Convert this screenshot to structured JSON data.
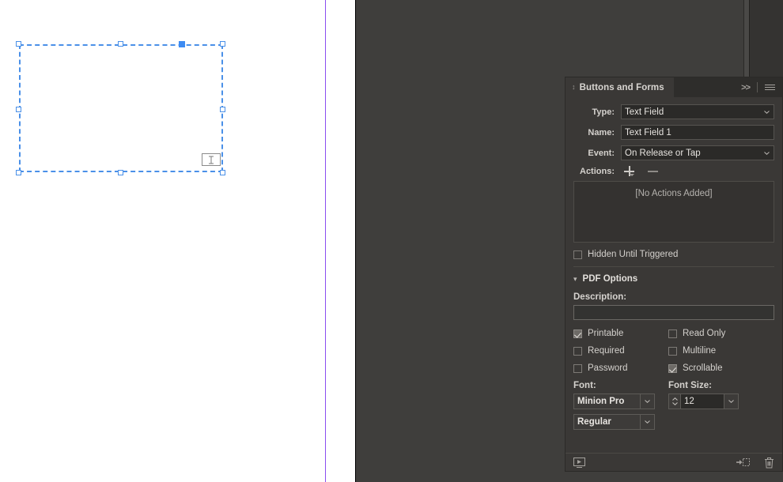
{
  "panel": {
    "tab_title": "Buttons and Forms",
    "dock_icon": "collapse-arrows-icon",
    "expand_icon": ">>",
    "menu_icon": "panel-menu-icon",
    "fields": {
      "type_label": "Type:",
      "type_value": "Text Field",
      "name_label": "Name:",
      "name_value": "Text Field 1",
      "event_label": "Event:",
      "event_value": "On Release or Tap",
      "actions_label": "Actions:",
      "add_action_label": "+",
      "remove_action_label": "−",
      "actions_empty": "[No Actions Added]"
    },
    "hidden_until_triggered": {
      "label": "Hidden Until Triggered",
      "checked": false
    },
    "pdf_options": {
      "title": "PDF Options",
      "expanded": true,
      "description_label": "Description:",
      "description_value": "",
      "checkboxes": [
        {
          "label": "Printable",
          "checked": true
        },
        {
          "label": "Read Only",
          "checked": false
        },
        {
          "label": "Required",
          "checked": false
        },
        {
          "label": "Multiline",
          "checked": false
        },
        {
          "label": "Password",
          "checked": false
        },
        {
          "label": "Scrollable",
          "checked": true
        }
      ],
      "font_label": "Font:",
      "font_family_value": "Minion Pro",
      "font_style_value": "Regular",
      "font_size_label": "Font Size:",
      "font_size_value": "12"
    },
    "footer": {
      "preview_icon": "preview-spread-icon",
      "convert_icon": "convert-to-object-icon",
      "delete_icon": "trash-icon"
    }
  },
  "canvas": {
    "selected_object": "text-field-1",
    "field_indicator_icon": "text-field-cursor-icon"
  },
  "colors": {
    "selection": "#4a90e8",
    "margin_guide": "#8a4df0",
    "panel_bg": "#3a3836",
    "workspace_bg": "#3f3e3c"
  }
}
